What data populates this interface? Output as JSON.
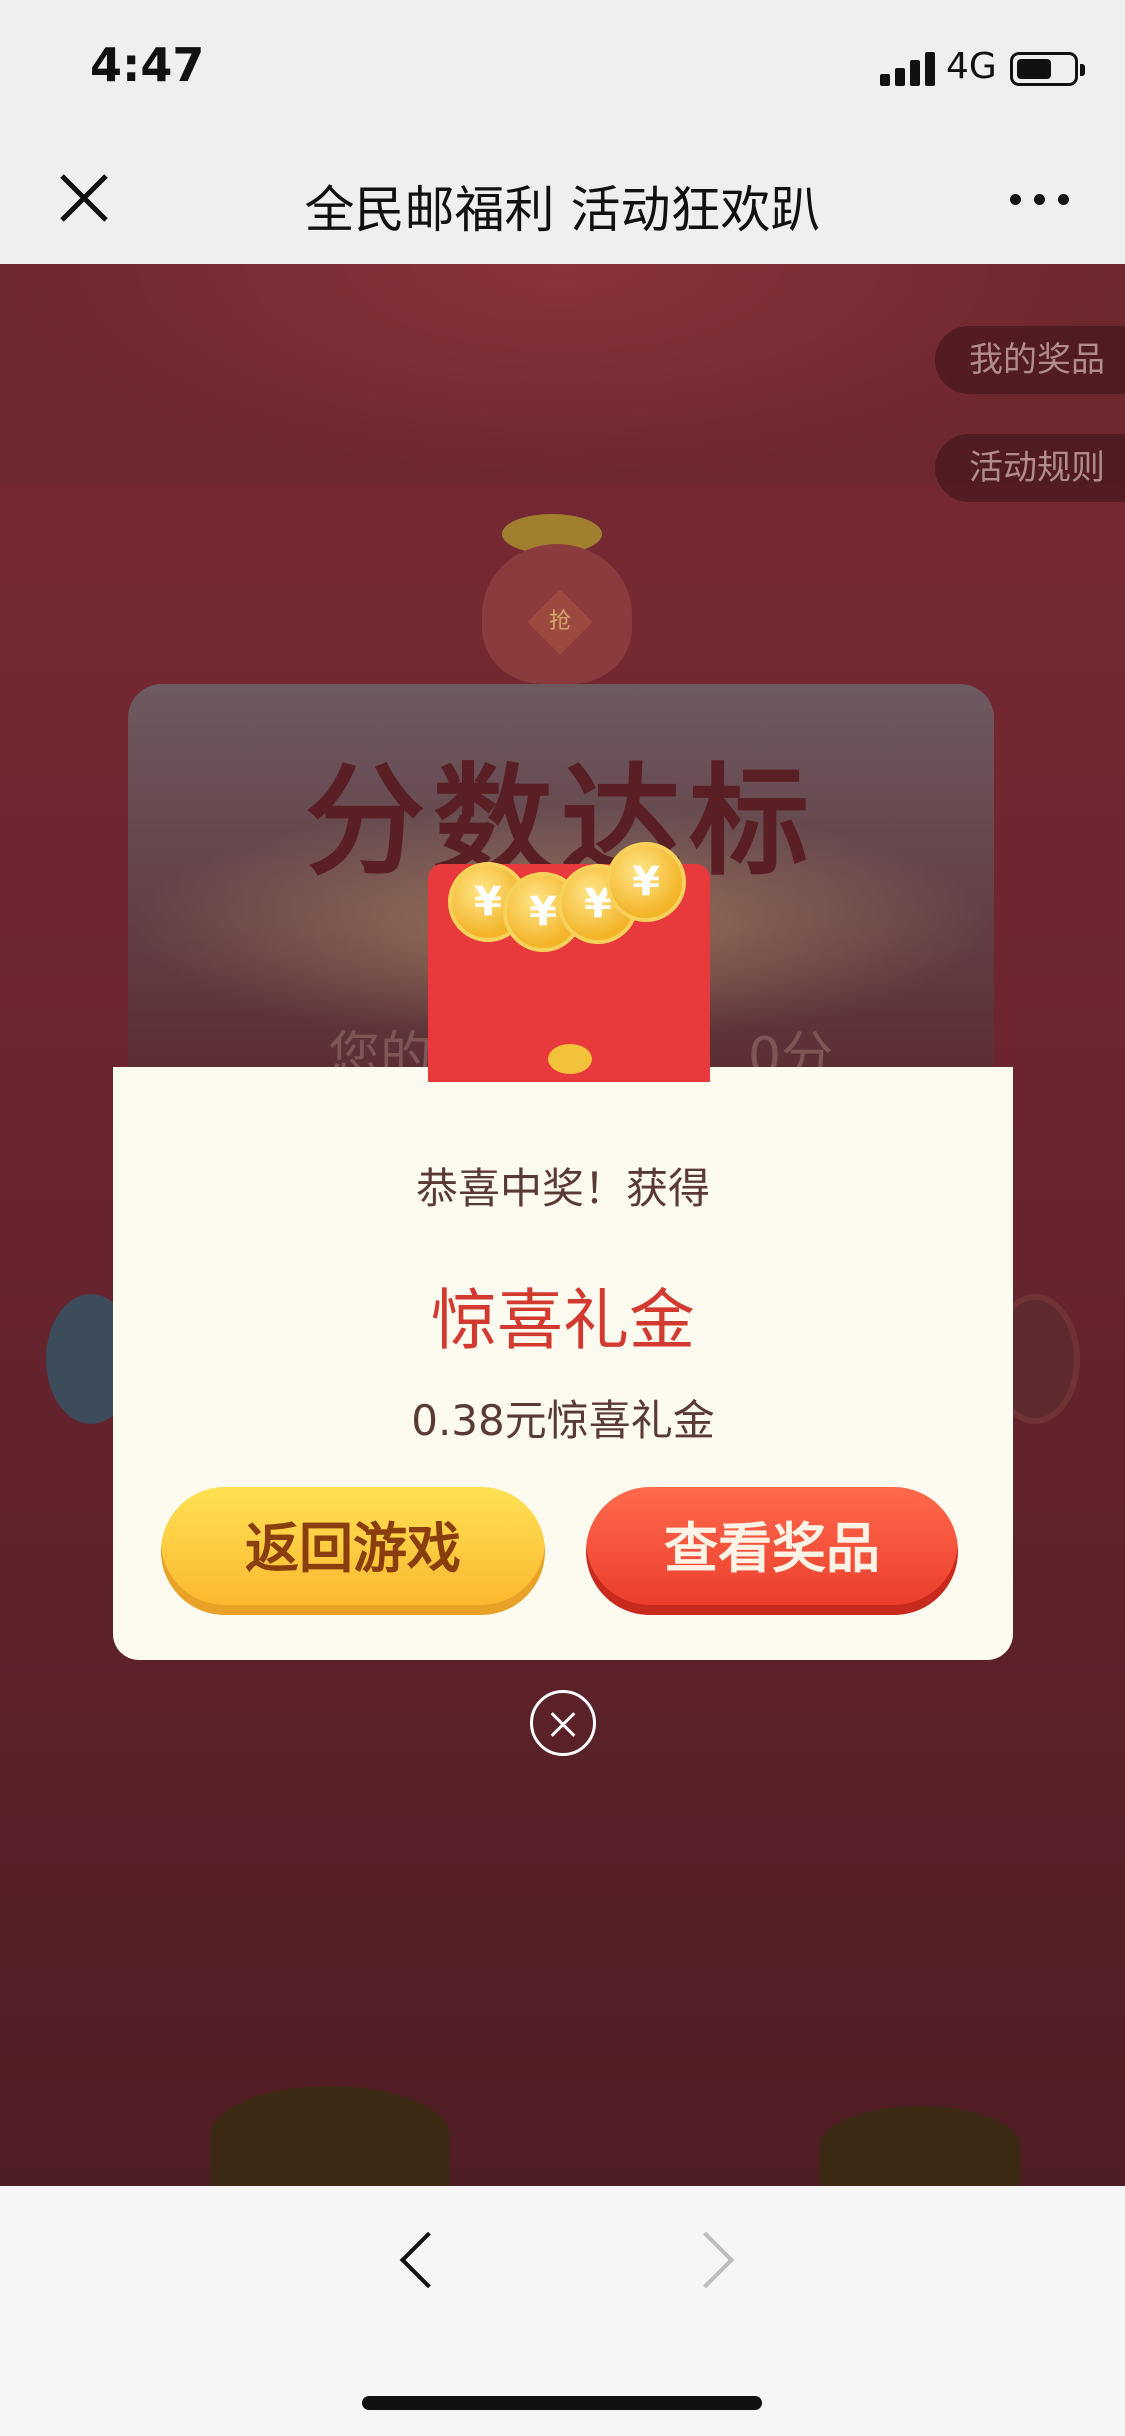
{
  "status_bar": {
    "time": "4:47",
    "network": "4G",
    "battery_level": 0.6
  },
  "nav": {
    "title": "全民邮福利 活动狂欢趴",
    "close_icon": "close-icon",
    "more_icon": "more-icon"
  },
  "game": {
    "my_prizes": "我的奖品",
    "rules": "活动规则",
    "bag_tag": "抢",
    "score_title": "分数达标",
    "score_sub_left": "您的",
    "score_sub_right": "0分"
  },
  "envelope": {
    "coin_symbol": "¥"
  },
  "modal": {
    "headline": "恭喜中奖！获得",
    "prize_name": "惊喜礼金",
    "prize_amount": "0.38元惊喜礼金",
    "back_button": "返回游戏",
    "view_button": "查看奖品"
  },
  "colors": {
    "accent_red": "#d2392f",
    "gold": "#fbb52d",
    "overlay_bg": "#6d2530"
  }
}
